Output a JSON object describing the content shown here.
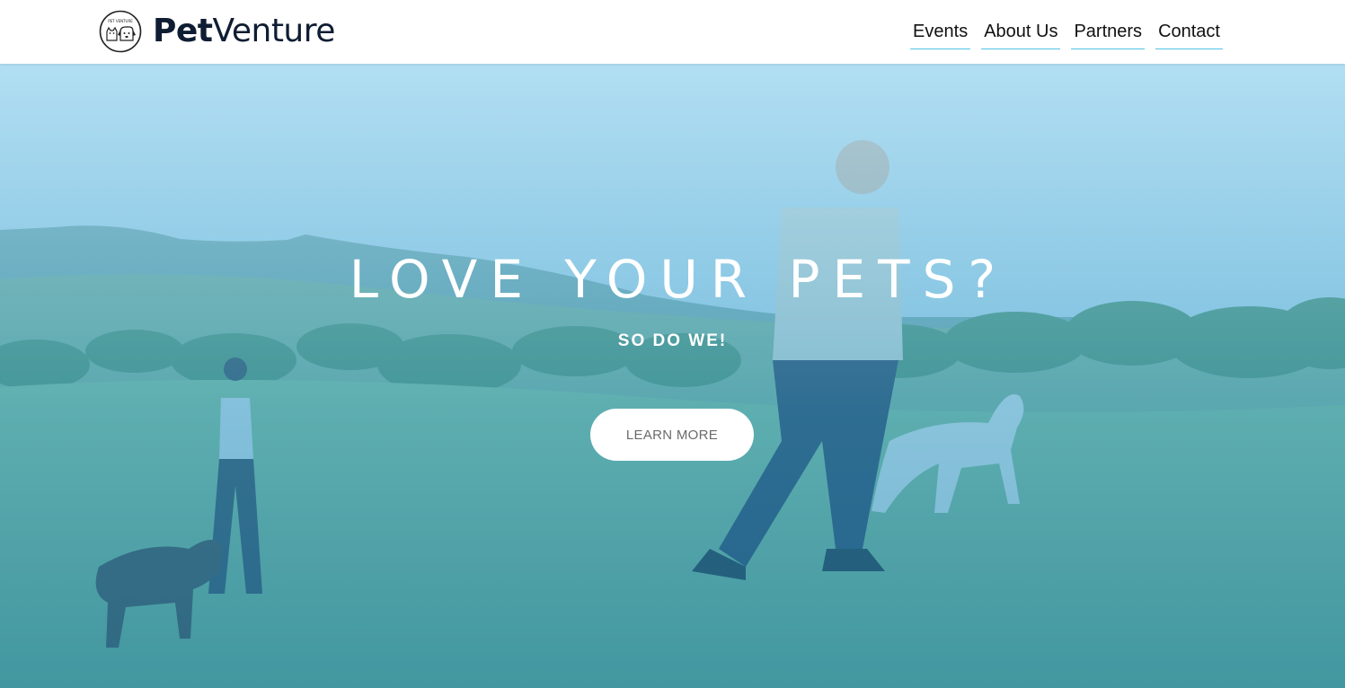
{
  "brand": {
    "name_bold": "Pet",
    "name_regular": "Venture",
    "logo_text": "PET VENTURE",
    "color": "#0f1d33"
  },
  "nav": {
    "items": [
      {
        "label": "Events"
      },
      {
        "label": "About Us"
      },
      {
        "label": "Partners"
      },
      {
        "label": "Contact"
      }
    ],
    "underline_color": "#4fc3e6"
  },
  "hero": {
    "title": "LOVE YOUR PETS?",
    "subtitle": "SO DO WE!",
    "cta_label": "LEARN MORE",
    "overlay_color": "#3ea6d3"
  }
}
